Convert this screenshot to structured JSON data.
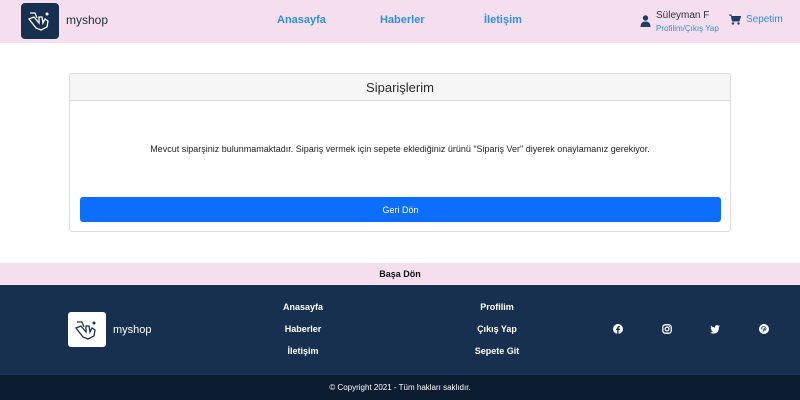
{
  "header": {
    "brand": "myshop",
    "nav": [
      "Anasayfa",
      "Haberler",
      "İletişim"
    ],
    "user_name": "Süleyman F",
    "user_links": "Profilim/Çıkış Yap",
    "cart_label": "Sepetim"
  },
  "main": {
    "card_title": "Siparişlerim",
    "message": "Mevcut siparşiniz bulunmamaktadır. Sipariş vermek için sepete eklediğiniz ürünü \"Sipariş Ver\" diyerek onaylamanız gerekiyor.",
    "back_button": "Geri Dön"
  },
  "back_to_top": "Başa Dön",
  "footer": {
    "brand": "myshop",
    "col1": [
      "Anasayfa",
      "Haberler",
      "İletişim"
    ],
    "col2": [
      "Profilim",
      "Çıkış Yap",
      "Sepete Git"
    ],
    "social_icons": [
      "facebook-icon",
      "instagram-icon",
      "twitter-icon",
      "pinterest-icon"
    ],
    "copyright": "© Copyright 2021 - Tüm hakları saklıdır."
  },
  "colors": {
    "header_bg": "#f5dfee",
    "link": "#2f8fe8",
    "primary_button": "#0d6efd",
    "footer_bg": "#17304f",
    "copyright_bg": "#0c1c30"
  }
}
